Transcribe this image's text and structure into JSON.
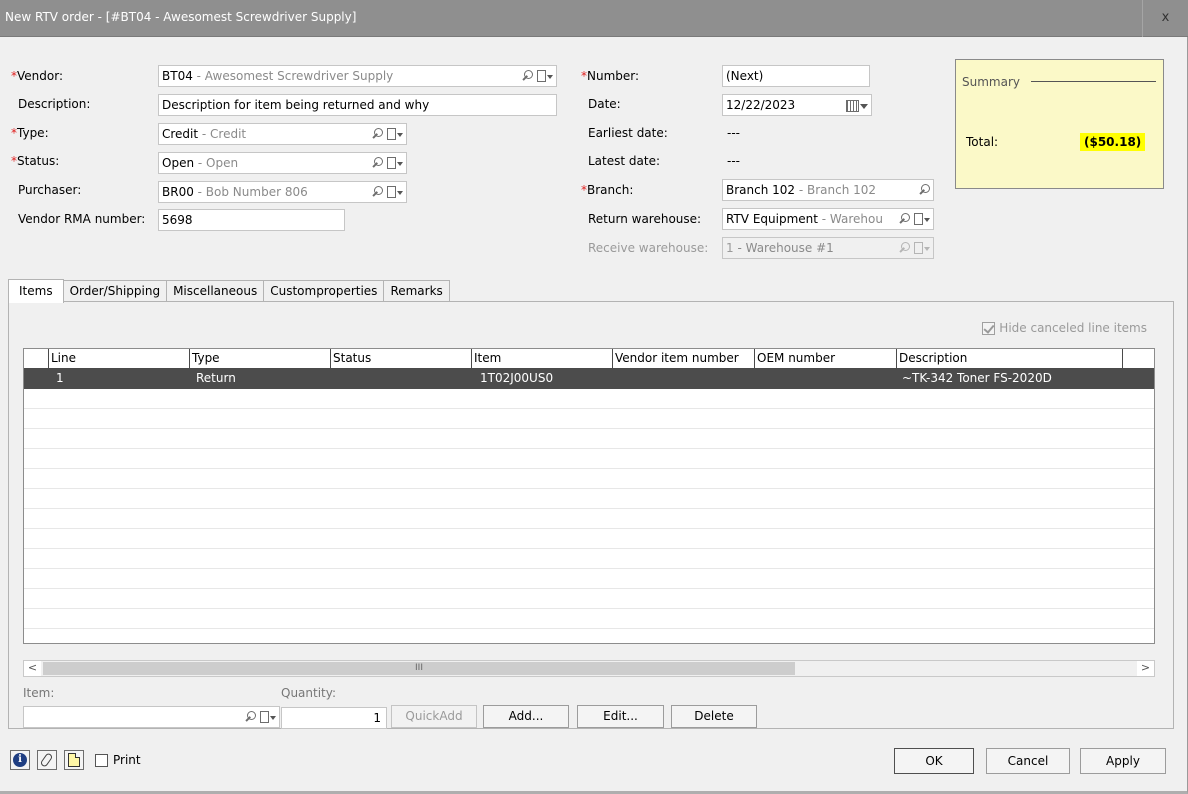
{
  "window": {
    "title": "New RTV order - [#BT04 - Awesomest Screwdriver Supply]",
    "close": "x"
  },
  "form": {
    "vendor": {
      "label": "Vendor:",
      "value": "BT04",
      "sub": " - Awesomest Screwdriver Supply"
    },
    "description": {
      "label": "Description:",
      "value": "Description for item being returned and why"
    },
    "type": {
      "label": "Type:",
      "value": "Credit",
      "sub": " - Credit"
    },
    "status": {
      "label": "Status:",
      "value": "Open",
      "sub": " - Open"
    },
    "purchaser": {
      "label": "Purchaser:",
      "value": "BR00",
      "sub": " - Bob Number 806"
    },
    "vendor_rma": {
      "label": "Vendor RMA number:",
      "value": "5698"
    },
    "number": {
      "label": "Number:",
      "value": "(Next)"
    },
    "date": {
      "label": "Date:",
      "value": "12/22/2023"
    },
    "earliest_date": {
      "label": "Earliest date:",
      "value": "---"
    },
    "latest_date": {
      "label": "Latest date:",
      "value": "---"
    },
    "branch": {
      "label": "Branch:",
      "value": "Branch 102",
      "sub": " - Branch 102"
    },
    "return_warehouse": {
      "label": "Return warehouse:",
      "value": "RTV Equipment",
      "sub": " - Warehou"
    },
    "receive_warehouse": {
      "label": "Receive warehouse:",
      "value": "1",
      "sub": " - Warehouse #1"
    }
  },
  "summary": {
    "title": "Summary",
    "total_label": "Total:",
    "total_value": "($50.18)"
  },
  "tabs": [
    "Items",
    "Order/Shipping",
    "Miscellaneous",
    "Customproperties",
    "Remarks"
  ],
  "items": {
    "hide_canceled_label": "Hide canceled line items",
    "hide_canceled_checked": true,
    "columns": [
      "Line",
      "Type",
      "Status",
      "Item",
      "Vendor item number",
      "OEM number",
      "Description"
    ],
    "rows": [
      {
        "line": "1",
        "type": "Return",
        "status": "",
        "item": "1T02J00US0",
        "vendor_item": "",
        "oem": "",
        "description": "~TK-342 Toner FS-2020D"
      }
    ],
    "scroll_left": "<",
    "scroll_right": ">",
    "scroll_grip": "III",
    "item_label": "Item:",
    "item_value": "",
    "quantity_label": "Quantity:",
    "quantity_value": "1",
    "quickadd_label": "QuickAdd",
    "add_label": "Add...",
    "edit_label": "Edit...",
    "delete_label": "Delete"
  },
  "footer": {
    "print_label": "Print",
    "ok_label": "OK",
    "cancel_label": "Cancel",
    "apply_label": "Apply"
  },
  "icons": {
    "info": "info-icon",
    "attach": "paperclip-icon",
    "notes": "notes-icon"
  },
  "colors": {
    "required": "#e0201f",
    "total_highlight": "#ffff00",
    "summary_bg": "#fbf9c8",
    "selected_row": "#4c4c4c"
  }
}
